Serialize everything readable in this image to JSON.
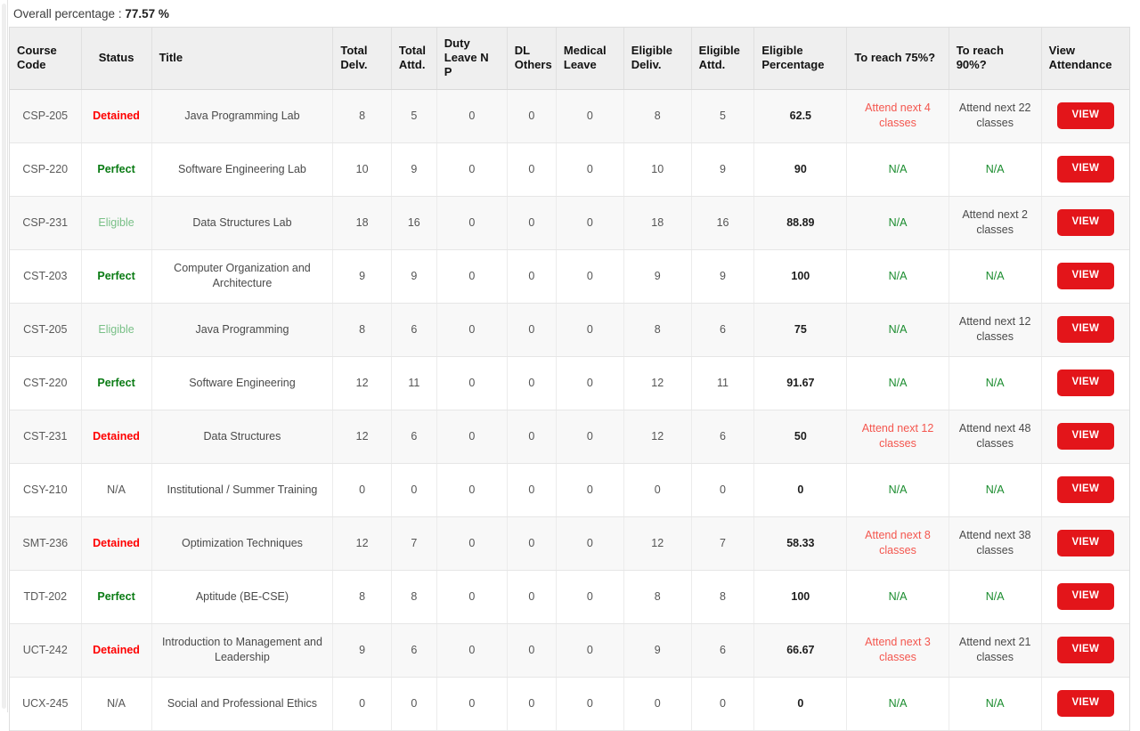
{
  "summary": {
    "label": "Overall percentage :",
    "value": "77.57 %"
  },
  "table": {
    "columns": [
      {
        "key": "course_code",
        "label": "Course Code"
      },
      {
        "key": "status",
        "label": "Status"
      },
      {
        "key": "title",
        "label": "Title"
      },
      {
        "key": "total_delv",
        "label": "Total Delv."
      },
      {
        "key": "total_attd",
        "label": "Total Attd."
      },
      {
        "key": "duty_leave_n_p",
        "label": "Duty Leave N P"
      },
      {
        "key": "dl_others",
        "label": "DL Others"
      },
      {
        "key": "medical_leave",
        "label": "Medical Leave"
      },
      {
        "key": "eligible_deliv",
        "label": "Eligible Deliv."
      },
      {
        "key": "eligible_attd",
        "label": "Eligible Attd."
      },
      {
        "key": "eligible_percentage",
        "label": "Eligible Percentage"
      },
      {
        "key": "to_reach_75",
        "label": "To reach 75%?"
      },
      {
        "key": "to_reach_90",
        "label": "To reach 90%?"
      },
      {
        "key": "view_attendance",
        "label": "View Attendance"
      }
    ],
    "view_button_label": "VIEW",
    "rows": [
      {
        "course_code": "CSP-205",
        "status": "Detained",
        "status_kind": "detained",
        "title": "Java Programming Lab",
        "total_delv": "8",
        "total_attd": "5",
        "duty_leave_n_p": "0",
        "dl_others": "0",
        "medical_leave": "0",
        "eligible_deliv": "8",
        "eligible_attd": "5",
        "eligible_percentage": "62.5",
        "to_reach_75": "Attend next 4 classes",
        "to_reach_75_kind": "attend",
        "to_reach_90": "Attend next 22 classes",
        "to_reach_90_kind": "attend"
      },
      {
        "course_code": "CSP-220",
        "status": "Perfect",
        "status_kind": "perfect",
        "title": "Software Engineering Lab",
        "total_delv": "10",
        "total_attd": "9",
        "duty_leave_n_p": "0",
        "dl_others": "0",
        "medical_leave": "0",
        "eligible_deliv": "10",
        "eligible_attd": "9",
        "eligible_percentage": "90",
        "to_reach_75": "N/A",
        "to_reach_75_kind": "na",
        "to_reach_90": "N/A",
        "to_reach_90_kind": "na"
      },
      {
        "course_code": "CSP-231",
        "status": "Eligible",
        "status_kind": "eligible",
        "title": "Data Structures Lab",
        "total_delv": "18",
        "total_attd": "16",
        "duty_leave_n_p": "0",
        "dl_others": "0",
        "medical_leave": "0",
        "eligible_deliv": "18",
        "eligible_attd": "16",
        "eligible_percentage": "88.89",
        "to_reach_75": "N/A",
        "to_reach_75_kind": "na",
        "to_reach_90": "Attend next 2 classes",
        "to_reach_90_kind": "attend"
      },
      {
        "course_code": "CST-203",
        "status": "Perfect",
        "status_kind": "perfect",
        "title": "Computer Organization and Architecture",
        "total_delv": "9",
        "total_attd": "9",
        "duty_leave_n_p": "0",
        "dl_others": "0",
        "medical_leave": "0",
        "eligible_deliv": "9",
        "eligible_attd": "9",
        "eligible_percentage": "100",
        "to_reach_75": "N/A",
        "to_reach_75_kind": "na",
        "to_reach_90": "N/A",
        "to_reach_90_kind": "na"
      },
      {
        "course_code": "CST-205",
        "status": "Eligible",
        "status_kind": "eligible",
        "title": "Java Programming",
        "total_delv": "8",
        "total_attd": "6",
        "duty_leave_n_p": "0",
        "dl_others": "0",
        "medical_leave": "0",
        "eligible_deliv": "8",
        "eligible_attd": "6",
        "eligible_percentage": "75",
        "to_reach_75": "N/A",
        "to_reach_75_kind": "na",
        "to_reach_90": "Attend next 12 classes",
        "to_reach_90_kind": "attend"
      },
      {
        "course_code": "CST-220",
        "status": "Perfect",
        "status_kind": "perfect",
        "title": "Software Engineering",
        "total_delv": "12",
        "total_attd": "11",
        "duty_leave_n_p": "0",
        "dl_others": "0",
        "medical_leave": "0",
        "eligible_deliv": "12",
        "eligible_attd": "11",
        "eligible_percentage": "91.67",
        "to_reach_75": "N/A",
        "to_reach_75_kind": "na",
        "to_reach_90": "N/A",
        "to_reach_90_kind": "na"
      },
      {
        "course_code": "CST-231",
        "status": "Detained",
        "status_kind": "detained",
        "title": "Data Structures",
        "total_delv": "12",
        "total_attd": "6",
        "duty_leave_n_p": "0",
        "dl_others": "0",
        "medical_leave": "0",
        "eligible_deliv": "12",
        "eligible_attd": "6",
        "eligible_percentage": "50",
        "to_reach_75": "Attend next 12 classes",
        "to_reach_75_kind": "attend",
        "to_reach_90": "Attend next 48 classes",
        "to_reach_90_kind": "attend"
      },
      {
        "course_code": "CSY-210",
        "status": "N/A",
        "status_kind": "na-status",
        "title": "Institutional / Summer Training",
        "total_delv": "0",
        "total_attd": "0",
        "duty_leave_n_p": "0",
        "dl_others": "0",
        "medical_leave": "0",
        "eligible_deliv": "0",
        "eligible_attd": "0",
        "eligible_percentage": "0",
        "to_reach_75": "N/A",
        "to_reach_75_kind": "na",
        "to_reach_90": "N/A",
        "to_reach_90_kind": "na"
      },
      {
        "course_code": "SMT-236",
        "status": "Detained",
        "status_kind": "detained",
        "title": "Optimization Techniques",
        "total_delv": "12",
        "total_attd": "7",
        "duty_leave_n_p": "0",
        "dl_others": "0",
        "medical_leave": "0",
        "eligible_deliv": "12",
        "eligible_attd": "7",
        "eligible_percentage": "58.33",
        "to_reach_75": "Attend next 8 classes",
        "to_reach_75_kind": "attend",
        "to_reach_90": "Attend next 38 classes",
        "to_reach_90_kind": "attend"
      },
      {
        "course_code": "TDT-202",
        "status": "Perfect",
        "status_kind": "perfect",
        "title": "Aptitude (BE-CSE)",
        "total_delv": "8",
        "total_attd": "8",
        "duty_leave_n_p": "0",
        "dl_others": "0",
        "medical_leave": "0",
        "eligible_deliv": "8",
        "eligible_attd": "8",
        "eligible_percentage": "100",
        "to_reach_75": "N/A",
        "to_reach_75_kind": "na",
        "to_reach_90": "N/A",
        "to_reach_90_kind": "na"
      },
      {
        "course_code": "UCT-242",
        "status": "Detained",
        "status_kind": "detained",
        "title": "Introduction to Management and Leadership",
        "total_delv": "9",
        "total_attd": "6",
        "duty_leave_n_p": "0",
        "dl_others": "0",
        "medical_leave": "0",
        "eligible_deliv": "9",
        "eligible_attd": "6",
        "eligible_percentage": "66.67",
        "to_reach_75": "Attend next 3 classes",
        "to_reach_75_kind": "attend",
        "to_reach_90": "Attend next 21 classes",
        "to_reach_90_kind": "attend"
      },
      {
        "course_code": "UCX-245",
        "status": "N/A",
        "status_kind": "na-status",
        "title": "Social and Professional Ethics",
        "total_delv": "0",
        "total_attd": "0",
        "duty_leave_n_p": "0",
        "dl_others": "0",
        "medical_leave": "0",
        "eligible_deliv": "0",
        "eligible_attd": "0",
        "eligible_percentage": "0",
        "to_reach_75": "N/A",
        "to_reach_75_kind": "na",
        "to_reach_90": "N/A",
        "to_reach_90_kind": "na"
      }
    ]
  },
  "colors": {
    "detained": "#ff0000",
    "perfect": "#0a7b14",
    "eligible": "#79c087",
    "na_green": "#1a8c2e",
    "attend_red": "#f4564e",
    "view_button": "#e3151a",
    "header_bg": "#efefef"
  }
}
